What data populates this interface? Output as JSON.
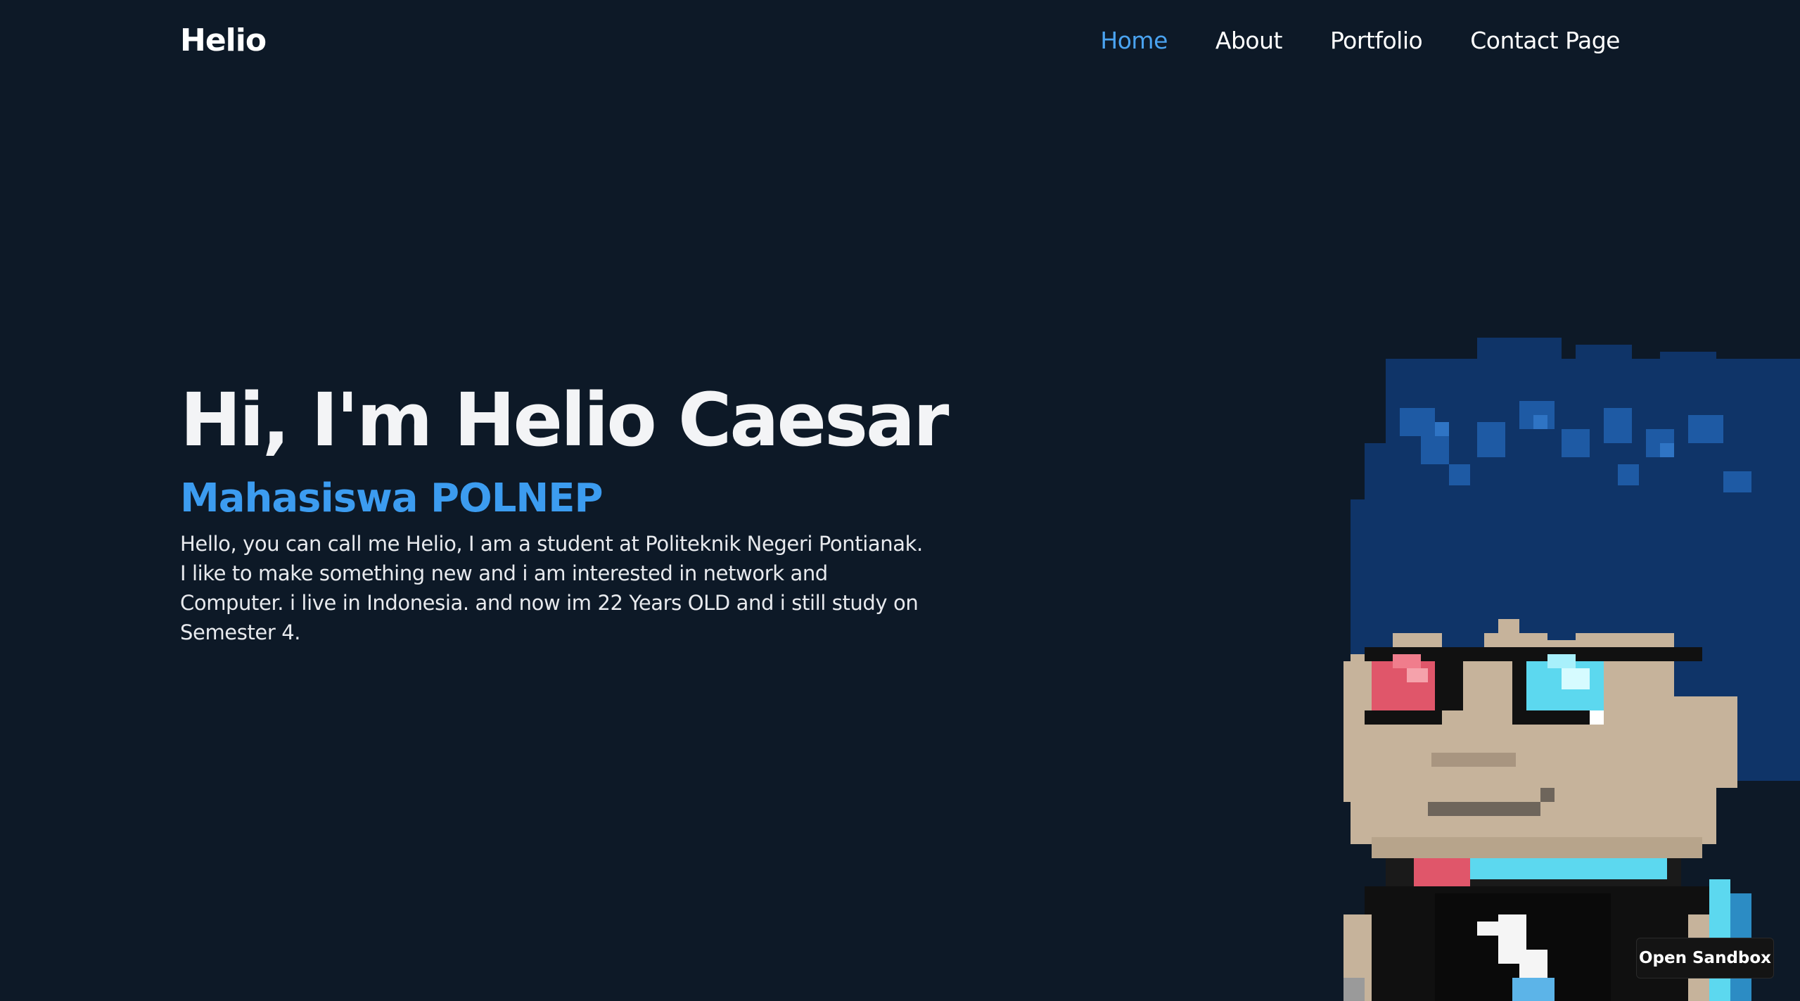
{
  "header": {
    "brand": "Helio",
    "nav": [
      {
        "label": "Home",
        "active": true
      },
      {
        "label": "About",
        "active": false
      },
      {
        "label": "Portfolio",
        "active": false
      },
      {
        "label": "Contact Page",
        "active": false
      }
    ]
  },
  "hero": {
    "title": "Hi, I'm Helio Caesar",
    "subtitle": "Mahasiswa POLNEP",
    "description": "Hello, you can call me Helio, I am a student at Politeknik Negeri Pontianak. I like to make something new and i am interested in network and Computer. i live in Indonesia. and now im 22 Years OLD and i still study on Semester 4."
  },
  "sandbox": {
    "label": "Open Sandbox"
  },
  "colors": {
    "background": "#0d1927",
    "accent": "#3c9cf0",
    "nav_active": "#4aa3f0"
  }
}
